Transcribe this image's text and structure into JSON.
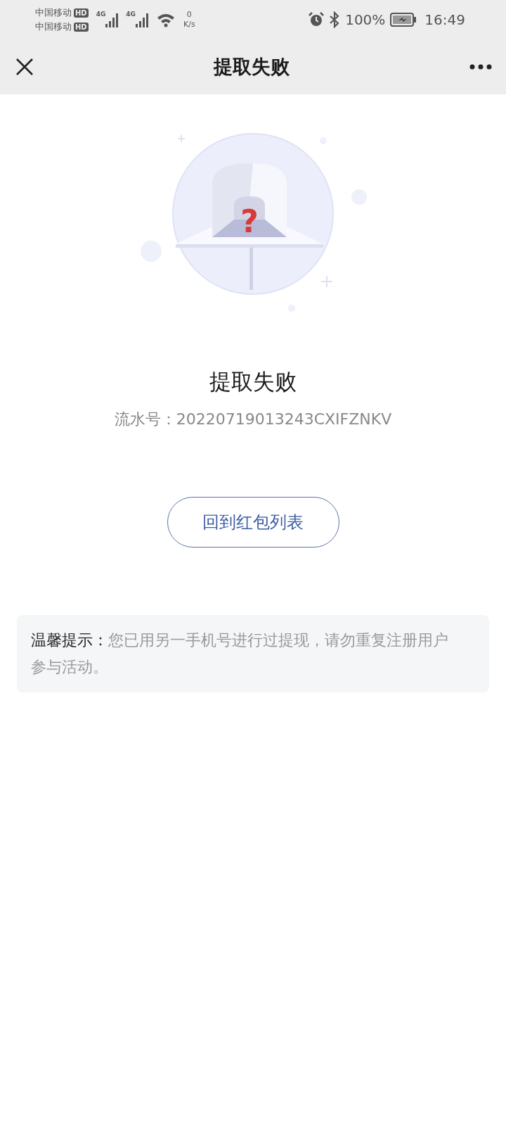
{
  "status_bar": {
    "carriers": [
      {
        "name": "中国移动",
        "badge": "HD"
      },
      {
        "name": "中国移动",
        "badge": "HD"
      }
    ],
    "networks": [
      "4G",
      "4G"
    ],
    "speed_value": "0",
    "speed_unit": "K/s",
    "battery": "100%",
    "time": "16:49"
  },
  "nav": {
    "title": "提取失败"
  },
  "illustration": {
    "mark": "?"
  },
  "result": {
    "title": "提取失败",
    "serial": "流水号：20220719013243CXIFZNKV"
  },
  "button": "回到红包列表",
  "tip": {
    "label": "温馨提示：",
    "text": "您已用另一手机号进行过提现，请勿重复注册用户参与活动。"
  }
}
